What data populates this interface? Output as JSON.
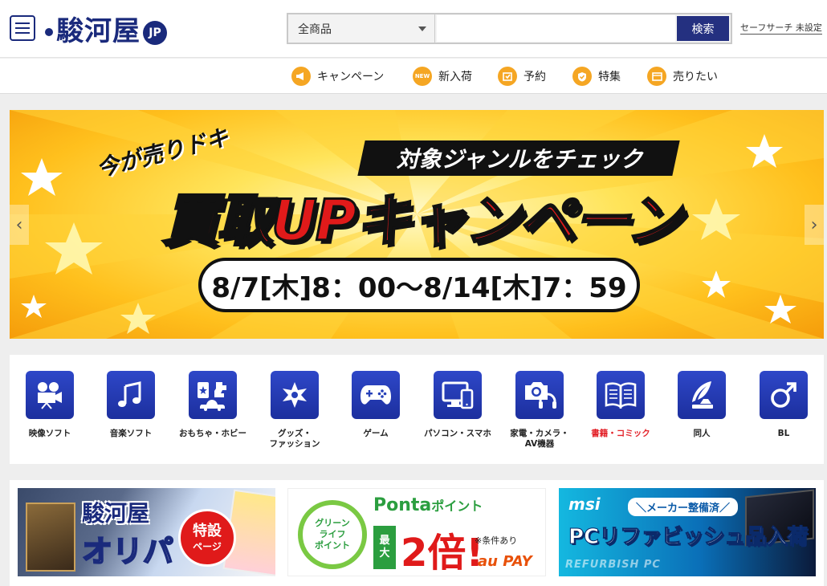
{
  "header": {
    "logo_text": "駿河屋",
    "logo_badge": "JP",
    "search_category": "全商品",
    "search_placeholder": "",
    "search_button": "検索",
    "safesearch_label": "セーフサーチ 未設定"
  },
  "nav": {
    "items": [
      {
        "label": "キャンペーン",
        "icon": "megaphone-icon"
      },
      {
        "label": "新入荷",
        "icon": "new-badge-icon",
        "icon_text": "NEW"
      },
      {
        "label": "予約",
        "icon": "reserve-icon"
      },
      {
        "label": "特集",
        "icon": "shield-check-icon"
      },
      {
        "label": "売りたい",
        "icon": "calendar-box-icon"
      }
    ]
  },
  "hero": {
    "sub": "今が売りドキ",
    "tag": "対象ジャンルをチェック",
    "main": "買取UPキャンペーン",
    "date": "8/7[木]8：00〜8/14[木]7：59",
    "prev": "‹",
    "next": "›"
  },
  "categories": [
    {
      "label": "映像ソフト",
      "icon": "video-camera-icon",
      "highlight": false
    },
    {
      "label": "音楽ソフト",
      "icon": "music-note-icon",
      "highlight": false
    },
    {
      "label": "おもちゃ・ホビー",
      "icon": "toy-hobby-icon",
      "highlight": false
    },
    {
      "label": "グッズ・\nファッション",
      "icon": "star-badge-icon",
      "highlight": false
    },
    {
      "label": "ゲーム",
      "icon": "gamepad-icon",
      "highlight": false
    },
    {
      "label": "パソコン・スマホ",
      "icon": "pc-phone-icon",
      "highlight": false
    },
    {
      "label": "家電・カメラ・\nAV機器",
      "icon": "camera-headphone-icon",
      "highlight": false
    },
    {
      "label": "書籍・コミック",
      "icon": "book-icon",
      "highlight": true
    },
    {
      "label": "同人",
      "icon": "quill-pen-icon",
      "highlight": false
    },
    {
      "label": "BL",
      "icon": "male-symbol-icon",
      "highlight": false
    }
  ],
  "promos": {
    "oripa": {
      "logo": "駿河屋",
      "title": "オリパ",
      "badge_1": "特設",
      "badge_2": "ページ"
    },
    "ponta": {
      "ring_1": "グリーン",
      "ring_2": "ライフ",
      "ring_3": "ポイント",
      "title": "Ponta",
      "title_suffix": "ポイント",
      "max_1": "最",
      "max_2": "大",
      "times": "2倍!",
      "note": "※条件あり",
      "pay": "au PAY"
    },
    "msi": {
      "brand": "msi",
      "tag": "＼メーカー整備済／",
      "title": "PCリファビッシュ品入荷",
      "refurb": "REFURBISH PC"
    }
  },
  "colors": {
    "brand_navy": "#1a2a7c",
    "nav_icon_orange": "#f5a623",
    "category_blue": "#2640b8",
    "highlight_red": "#e3242b"
  }
}
